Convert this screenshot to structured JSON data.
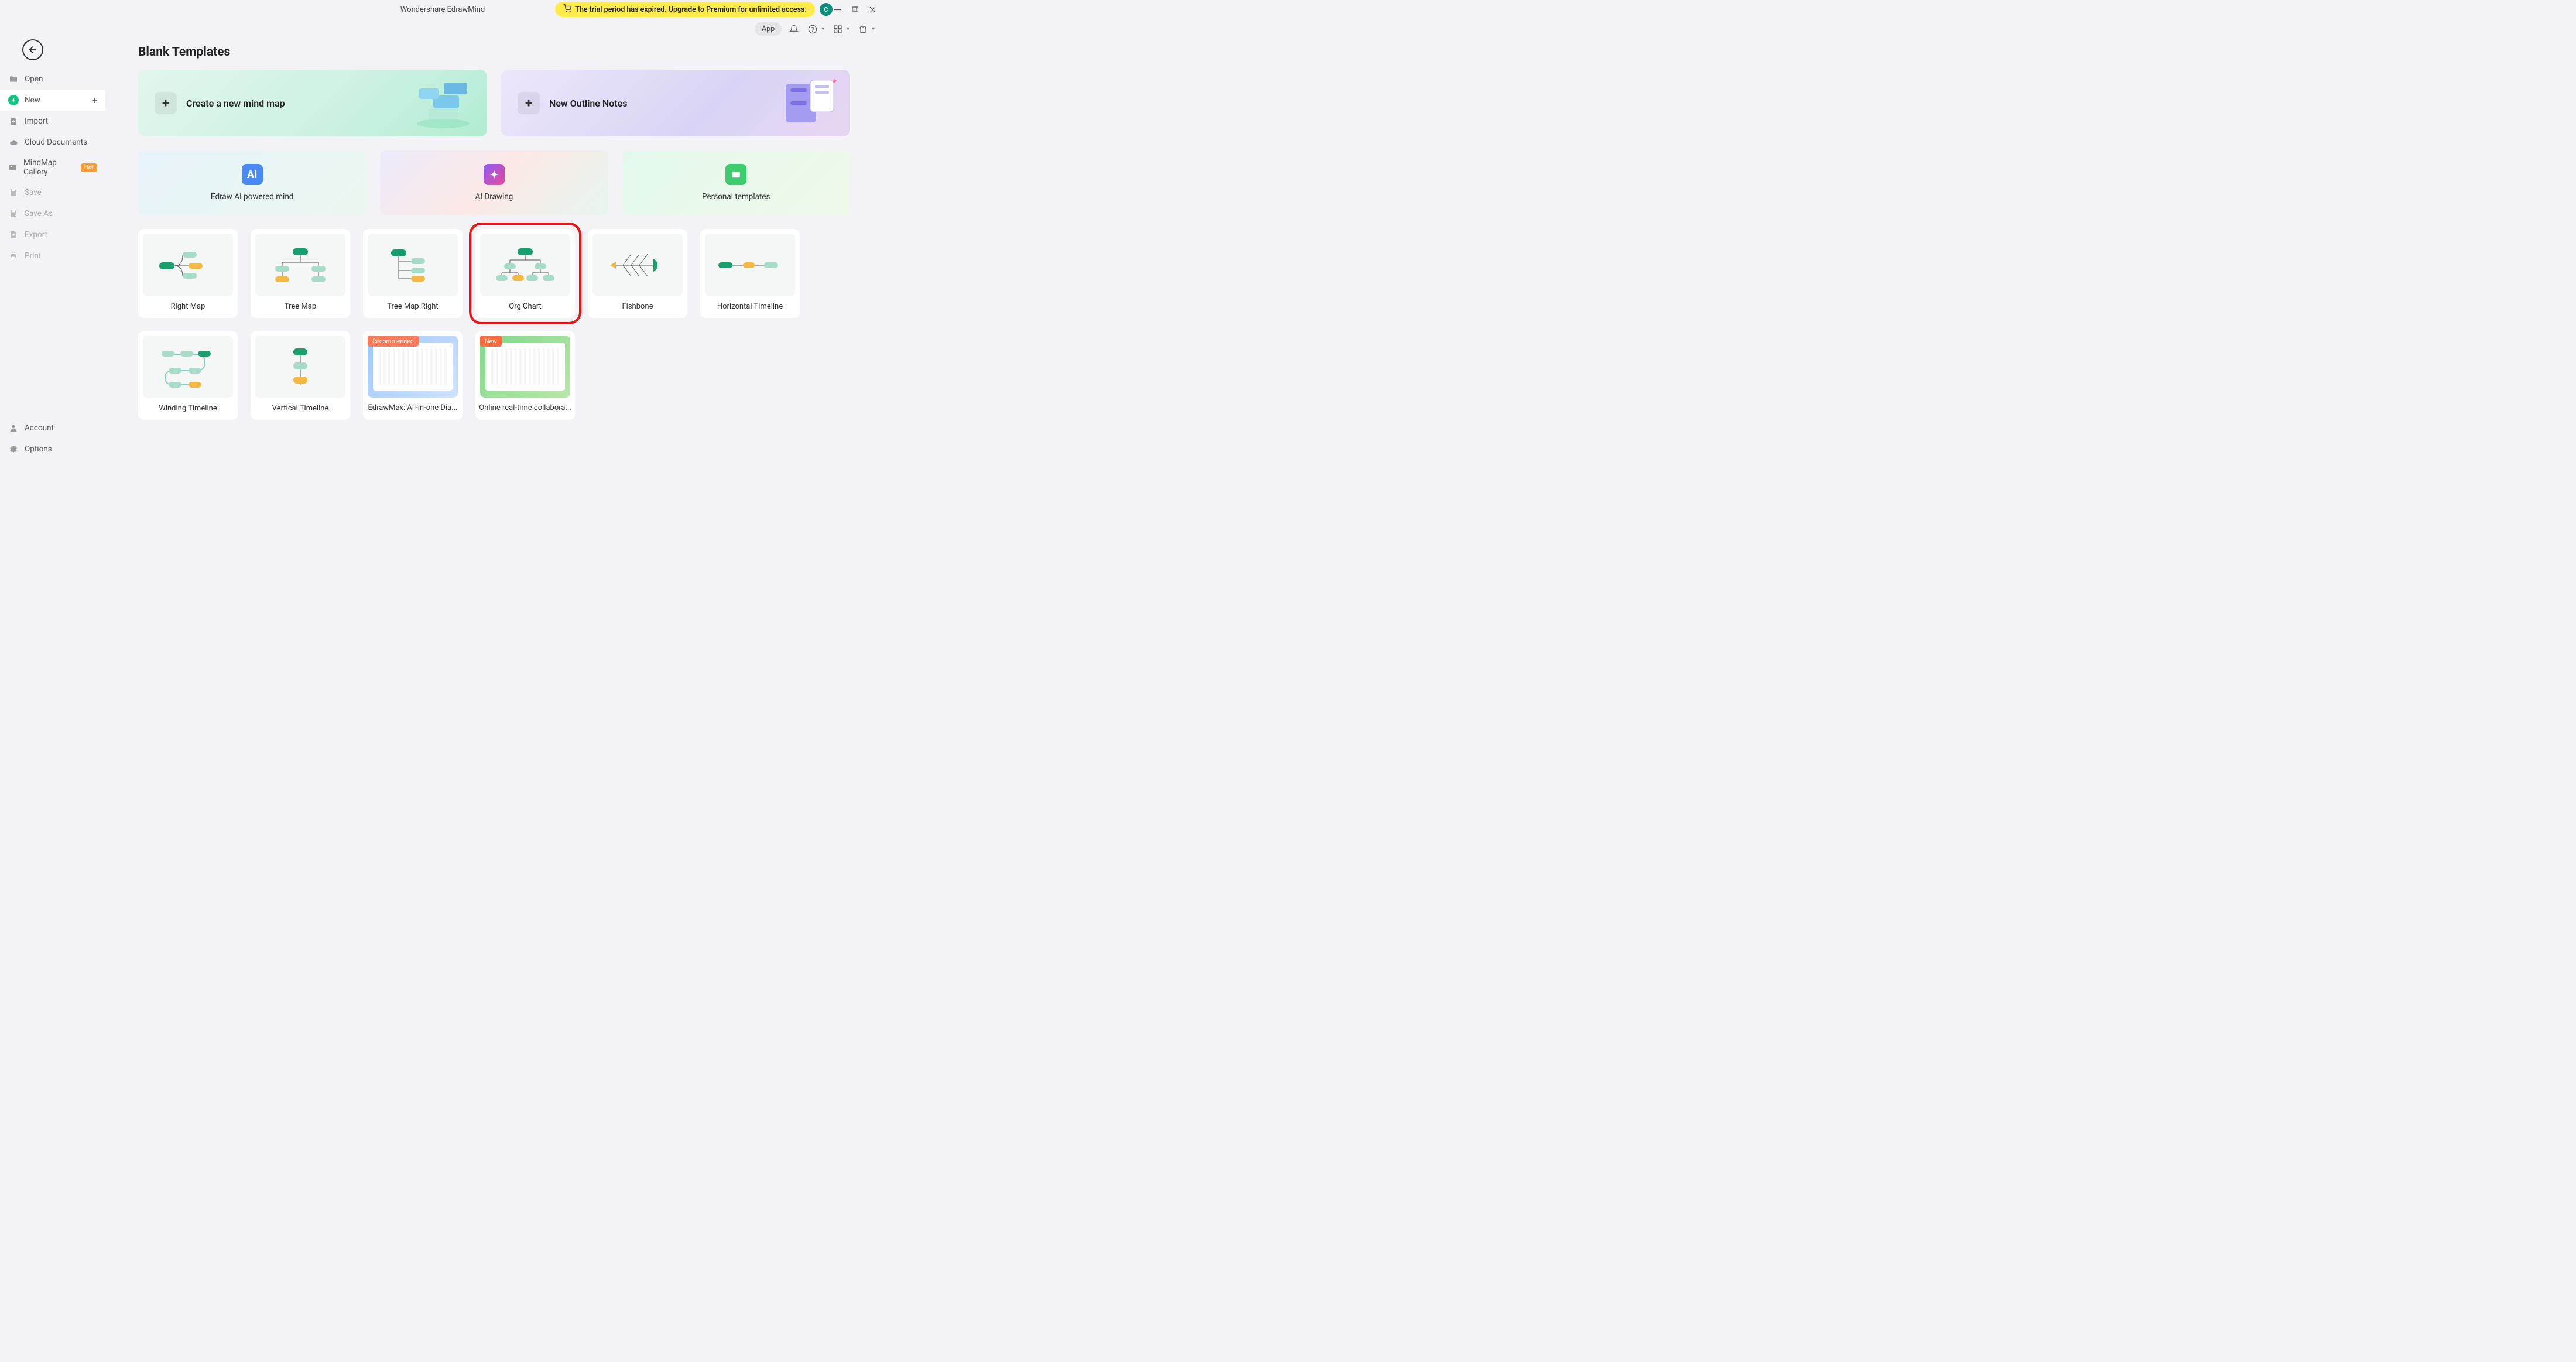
{
  "titlebar": {
    "app_title": "Wondershare EdrawMind",
    "trial_text": "The trial period has expired. Upgrade to Premium for unlimited access.",
    "avatar_letter": "C"
  },
  "toolbar": {
    "app_label": "App"
  },
  "sidebar": {
    "items": [
      {
        "id": "open",
        "label": "Open"
      },
      {
        "id": "new",
        "label": "New"
      },
      {
        "id": "import",
        "label": "Import"
      },
      {
        "id": "cloud",
        "label": "Cloud Documents"
      },
      {
        "id": "gallery",
        "label": "MindMap Gallery",
        "badge": "Hot"
      },
      {
        "id": "save",
        "label": "Save"
      },
      {
        "id": "saveas",
        "label": "Save As"
      },
      {
        "id": "export",
        "label": "Export"
      },
      {
        "id": "print",
        "label": "Print"
      }
    ],
    "bottom": [
      {
        "id": "account",
        "label": "Account"
      },
      {
        "id": "options",
        "label": "Options"
      }
    ]
  },
  "main": {
    "title": "Blank Templates",
    "hero": [
      {
        "id": "mindmap",
        "label": "Create a new mind map"
      },
      {
        "id": "outline",
        "label": "New Outline Notes"
      }
    ],
    "features": [
      {
        "id": "ai",
        "label": "Edraw AI powered mind"
      },
      {
        "id": "drawing",
        "label": "AI Drawing"
      },
      {
        "id": "personal",
        "label": "Personal templates"
      }
    ],
    "templates": [
      {
        "id": "rightmap",
        "label": "Right Map"
      },
      {
        "id": "treemap",
        "label": "Tree Map"
      },
      {
        "id": "treemapright",
        "label": "Tree Map Right"
      },
      {
        "id": "orgchart",
        "label": "Org Chart",
        "highlighted": true
      },
      {
        "id": "fishbone",
        "label": "Fishbone"
      },
      {
        "id": "htimeline",
        "label": "Horizontal Timeline"
      },
      {
        "id": "winding",
        "label": "Winding Timeline"
      },
      {
        "id": "vtimeline",
        "label": "Vertical Timeline"
      },
      {
        "id": "edrawmax",
        "label": "EdrawMax: All-in-one Dia...",
        "badge": "Recommended"
      },
      {
        "id": "collab",
        "label": "Online real-time collabora...",
        "badge": "New"
      }
    ]
  }
}
